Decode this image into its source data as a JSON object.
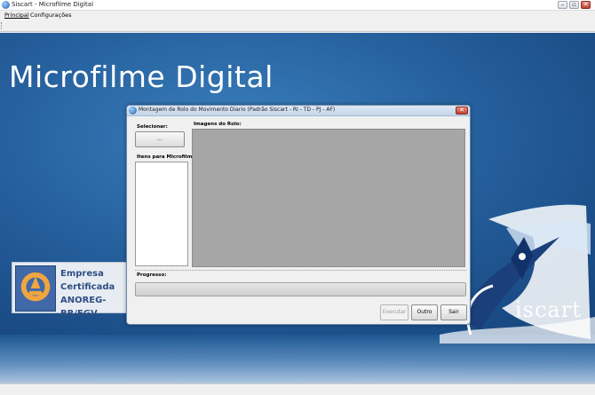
{
  "window": {
    "title": "Siscart - Microfilme Digital",
    "min_glyph": "–",
    "max_glyph": "▫",
    "close_glyph": "✕"
  },
  "menu": {
    "items": [
      {
        "label": "Principal"
      },
      {
        "label": "Configurações"
      }
    ]
  },
  "desktop": {
    "title": "Microfilme Digital",
    "logo_text": "iscart",
    "badge": {
      "line1": "Empresa",
      "line2": "Certificada",
      "line3": "ANOREG-BR/FGV"
    }
  },
  "dialog": {
    "title": "Montagem de Rolo do Movimento Diario (Padrão Siscart - RI - TD - PJ - AF)",
    "close_glyph": "✕",
    "selecionar_label": "Selecionar:",
    "browse_label": "...",
    "itens_label": "Itens para Microfilme:",
    "imagens_label": "Imagens do Rolo:",
    "progresso_label": "Progresso:",
    "progress_fraction": 0,
    "buttons": {
      "executar": "Executar",
      "outro": "Outro",
      "sair": "Sair"
    }
  },
  "icons": {
    "app": "siscart-app-icon",
    "dialog": "siscart-dialog-icon"
  },
  "colors": {
    "desktop_blue": "#27629f",
    "dialog_border": "#6b87ab",
    "images_panel": "#a6a6a6",
    "close_red": "#c24431"
  }
}
